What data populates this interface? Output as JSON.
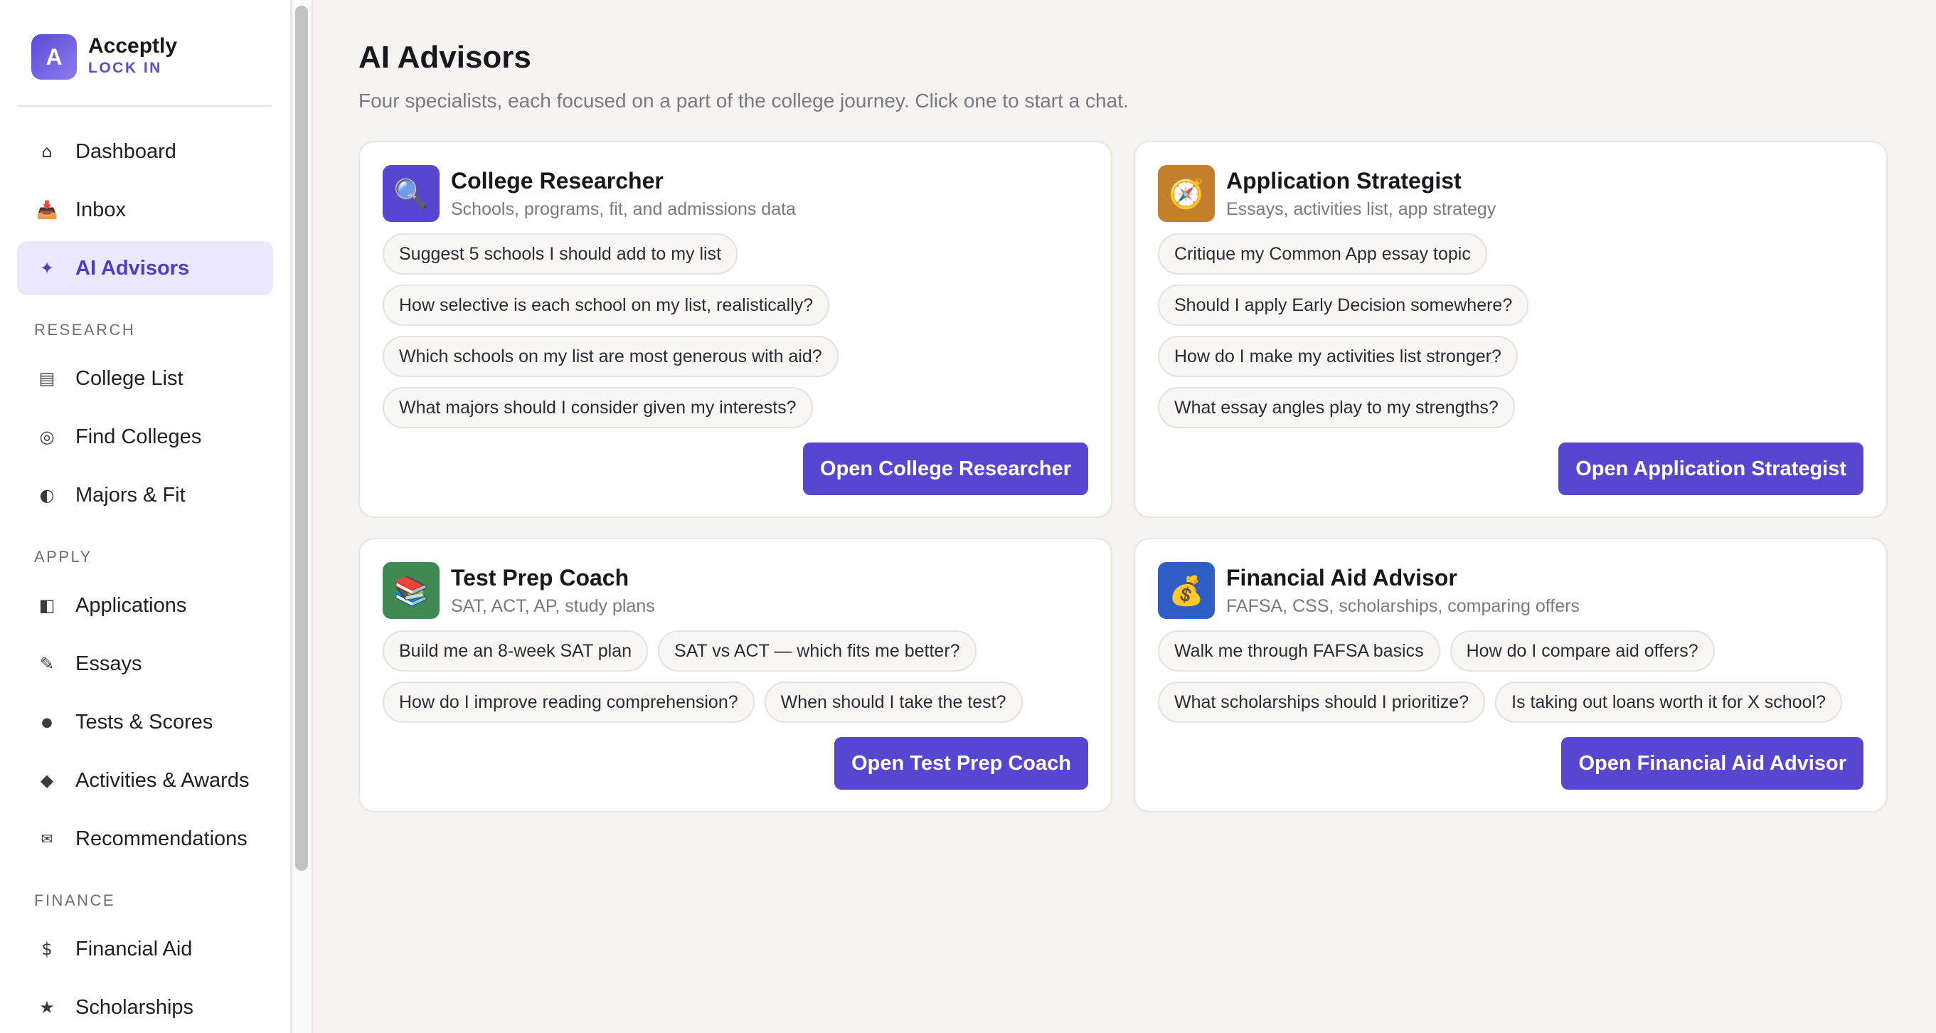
{
  "brand": {
    "logo_letter": "A",
    "name": "Acceptly",
    "tagline": "LOCK IN"
  },
  "sidebar": {
    "top_items": [
      {
        "label": "Dashboard",
        "icon": "home-icon",
        "glyph": "⌂"
      },
      {
        "label": "Inbox",
        "icon": "inbox-icon",
        "glyph": "📥"
      },
      {
        "label": "AI Advisors",
        "icon": "sparkle-icon",
        "glyph": "✦",
        "active": true
      }
    ],
    "sections": [
      {
        "label": "RESEARCH",
        "items": [
          {
            "label": "College List",
            "icon": "list-icon",
            "glyph": "▤"
          },
          {
            "label": "Find Colleges",
            "icon": "target-icon",
            "glyph": "◎"
          },
          {
            "label": "Majors & Fit",
            "icon": "half-circle-icon",
            "glyph": "◐"
          }
        ]
      },
      {
        "label": "APPLY",
        "items": [
          {
            "label": "Applications",
            "icon": "application-icon",
            "glyph": "◧"
          },
          {
            "label": "Essays",
            "icon": "pencil-icon",
            "glyph": "✎"
          },
          {
            "label": "Tests & Scores",
            "icon": "dot-icon",
            "glyph": "●"
          },
          {
            "label": "Activities & Awards",
            "icon": "diamond-icon",
            "glyph": "◆"
          },
          {
            "label": "Recommendations",
            "icon": "envelope-icon",
            "glyph": "✉"
          }
        ]
      },
      {
        "label": "FINANCE",
        "items": [
          {
            "label": "Financial Aid",
            "icon": "dollar-icon",
            "glyph": "$"
          },
          {
            "label": "Scholarships",
            "icon": "star-icon",
            "glyph": "★"
          }
        ]
      }
    ]
  },
  "main": {
    "title": "AI Advisors",
    "subtitle": "Four specialists, each focused on a part of the college journey. Click one to start a chat.",
    "advisors": [
      {
        "title": "College Researcher",
        "description": "Schools, programs, fit, and admissions data",
        "icon": "magnifier-icon",
        "glyph": "🔍",
        "icon_color": "#5646d0",
        "prompts": [
          "Suggest 5 schools I should add to my list",
          "How selective is each school on my list, realistically?",
          "Which schools on my list are most generous with aid?",
          "What majors should I consider given my interests?"
        ],
        "button": "Open College Researcher"
      },
      {
        "title": "Application Strategist",
        "description": "Essays, activities list, app strategy",
        "icon": "compass-icon",
        "glyph": "🧭",
        "icon_color": "#c47f2c",
        "prompts": [
          "Critique my Common App essay topic",
          "Should I apply Early Decision somewhere?",
          "How do I make my activities list stronger?",
          "What essay angles play to my strengths?"
        ],
        "button": "Open Application Strategist"
      },
      {
        "title": "Test Prep Coach",
        "description": "SAT, ACT, AP, study plans",
        "icon": "books-icon",
        "glyph": "📚",
        "icon_color": "#3f8a52",
        "prompts": [
          "Build me an 8-week SAT plan",
          "SAT vs ACT — which fits me better?",
          "How do I improve reading comprehension?",
          "When should I take the test?"
        ],
        "button": "Open Test Prep Coach"
      },
      {
        "title": "Financial Aid Advisor",
        "description": "FAFSA, CSS, scholarships, comparing offers",
        "icon": "money-bag-icon",
        "glyph": "💰",
        "icon_color": "#2f5fc4",
        "prompts": [
          "Walk me through FAFSA basics",
          "How do I compare aid offers?",
          "What scholarships should I prioritize?",
          "Is taking out loans worth it for X school?"
        ],
        "button": "Open Financial Aid Advisor"
      }
    ]
  }
}
